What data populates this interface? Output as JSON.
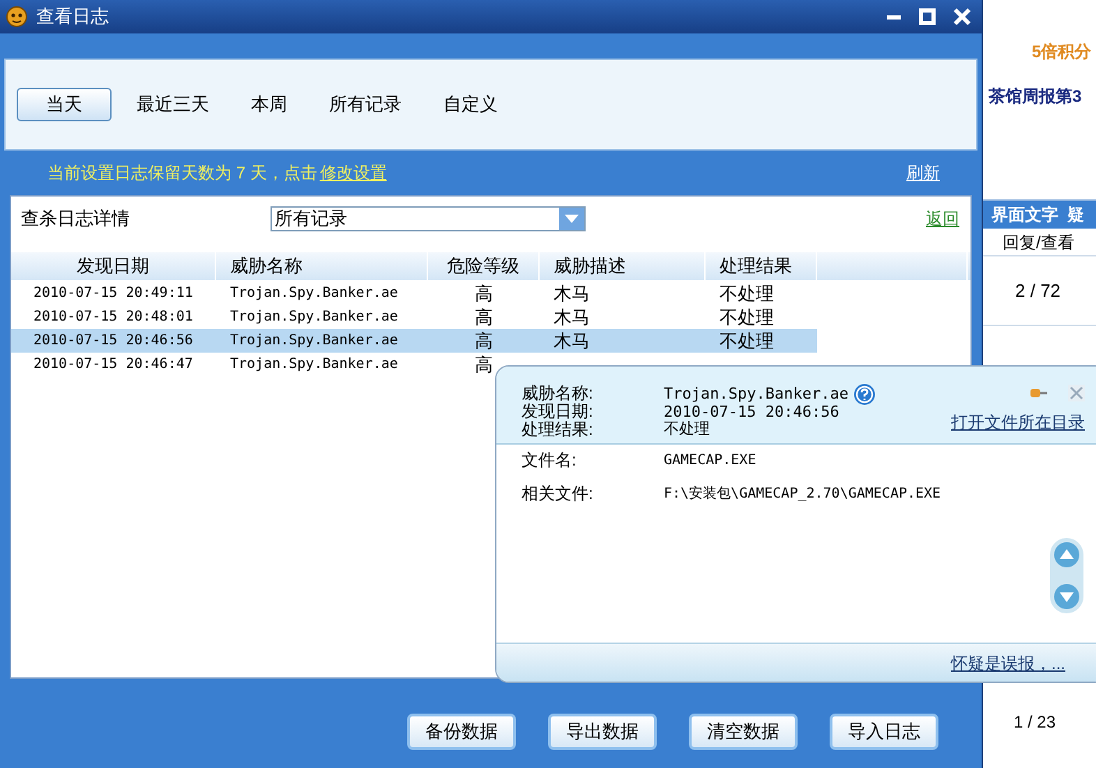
{
  "window": {
    "title": "查看日志"
  },
  "tabs": [
    {
      "label": "当天",
      "selected": true
    },
    {
      "label": "最近三天",
      "selected": false
    },
    {
      "label": "本周",
      "selected": false
    },
    {
      "label": "所有记录",
      "selected": false
    },
    {
      "label": "自定义",
      "selected": false
    }
  ],
  "notice": {
    "text": "当前设置日志保留天数为 7 天，点击",
    "link": "修改设置"
  },
  "refresh_link": "刷新",
  "details": {
    "title": "查杀日志详情",
    "filter": "所有记录",
    "back_link": "返回"
  },
  "table": {
    "columns": [
      "发现日期",
      "威胁名称",
      "危险等级",
      "威胁描述",
      "处理结果"
    ],
    "rows": [
      {
        "cells": [
          "2010-07-15 20:49:11",
          "Trojan.Spy.Banker.ae",
          "高",
          "木马",
          "不处理"
        ],
        "selected": false
      },
      {
        "cells": [
          "2010-07-15 20:48:01",
          "Trojan.Spy.Banker.ae",
          "高",
          "木马",
          "不处理"
        ],
        "selected": false
      },
      {
        "cells": [
          "2010-07-15 20:46:56",
          "Trojan.Spy.Banker.ae",
          "高",
          "木马",
          "不处理"
        ],
        "selected": true
      },
      {
        "cells": [
          "2010-07-15 20:46:47",
          "Trojan.Spy.Banker.ae",
          "高"
        ],
        "selected": false
      }
    ]
  },
  "popup": {
    "fields": [
      {
        "label": "威胁名称:",
        "value": "Trojan.Spy.Banker.ae"
      },
      {
        "label": "发现日期:",
        "value": "2010-07-15 20:46:56"
      },
      {
        "label": "处理结果:",
        "value": "不处理"
      }
    ],
    "open_folder_link": "打开文件所在目录",
    "files": [
      {
        "label": "文件名:",
        "value": "GAMECAP.EXE"
      },
      {
        "label": "相关文件:",
        "value": "F:\\安装包\\GAMECAP_2.70\\GAMECAP.EXE"
      }
    ],
    "report_link": "怀疑是误报，..."
  },
  "buttons": [
    "备份数据",
    "导出数据",
    "清空数据",
    "导入日志"
  ],
  "background_page": {
    "promo": "5倍积分",
    "headline": "茶馆周报第3",
    "table_header": "界面文字  疑",
    "column": "回复/查看",
    "rows": [
      "2 / 72"
    ],
    "pager": "1 / 23"
  }
}
